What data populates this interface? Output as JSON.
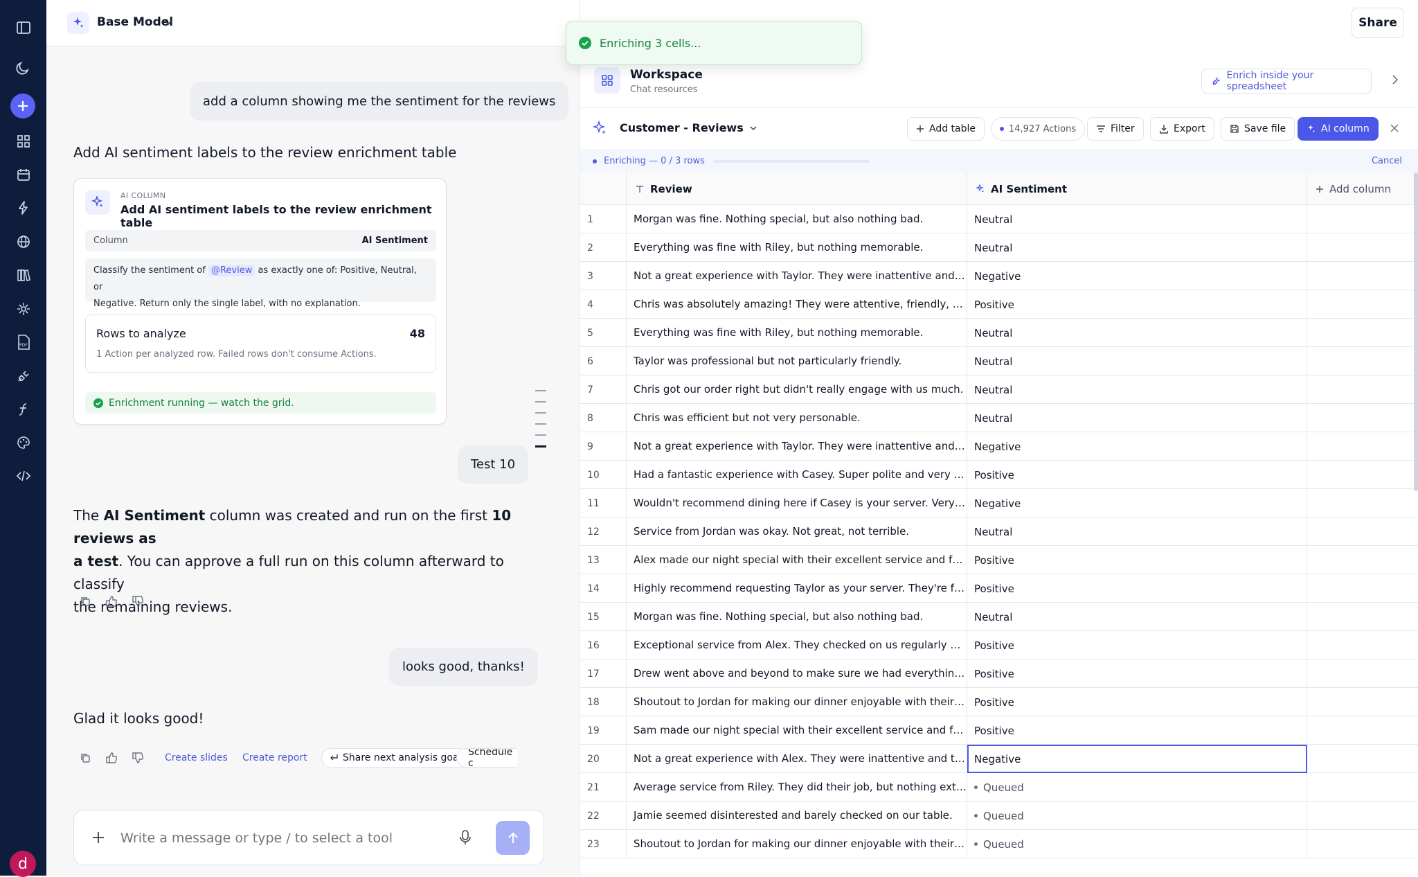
{
  "toast": {
    "text": "Enriching 3 cells..."
  },
  "chat": {
    "model_name": "Base Model",
    "user_msg_1": "add a column showing me the sentiment for the reviews",
    "assistant_heading": "Add AI sentiment labels to the review enrichment table",
    "card": {
      "kicker": "AI COLUMN",
      "title": "Add AI sentiment labels to the review enrichment table",
      "column_key": "Column",
      "column_value": "AI Sentiment",
      "prompt_prefix": "Classify the sentiment of",
      "prompt_mention": "@Review",
      "prompt_line1_rest": "as exactly one of: Positive, Neutral, or",
      "prompt_line2": "Negative. Return only the single label, with no explanation.",
      "rows_label": "Rows to analyze",
      "rows_count": "48",
      "rows_desc": "1 Action per analyzed row. Failed rows don't consume Actions.",
      "status": "Enrichment running — watch the grid."
    },
    "user_msg_2": "Test 10",
    "assistant_msg_2": {
      "p1": "The ",
      "b1": "AI Sentiment",
      "p2": " column was created and run on the first ",
      "b2": "10 reviews as",
      "b3": "a test",
      "p3": ". You can approve a full run on this column afterward to classify",
      "p4": "the remaining reviews."
    },
    "user_msg_3": "looks good, thanks!",
    "assistant_msg_3": "Glad it looks good!",
    "actions": {
      "create_slides": "Create slides",
      "create_report": "Create report",
      "share_goal": "Share next analysis goal",
      "schedule": "Schedule c"
    },
    "composer_placeholder": "Write a message or type / to select a tool"
  },
  "panel": {
    "share_label": "Share",
    "workspace_title": "Workspace",
    "workspace_sub": "Chat resources",
    "enrich_link": "Enrich inside your spreadsheet",
    "table_title": "Customer - Reviews",
    "add_table": "Add table",
    "actions_count": "14,927 Actions",
    "filter": "Filter",
    "export": "Export",
    "save_file": "Save file",
    "ai_column": "AI column",
    "progress_text": "Enriching — 0 / 3 rows",
    "progress_fraction": 0.0,
    "cancel": "Cancel",
    "col_review": "Review",
    "col_sentiment": "AI Sentiment",
    "col_add": "Add column",
    "rows": [
      {
        "n": "1",
        "review": "Morgan was fine. Nothing special, but also nothing bad.",
        "sentiment": "Neutral"
      },
      {
        "n": "2",
        "review": "Everything was fine with Riley, but nothing memorable.",
        "sentiment": "Neutral"
      },
      {
        "n": "3",
        "review": "Not a great experience with Taylor. They were inattentive and took...",
        "sentiment": "Negative"
      },
      {
        "n": "4",
        "review": "Chris was absolutely amazing! They were attentive, friendly, and m...",
        "sentiment": "Positive"
      },
      {
        "n": "5",
        "review": "Everything was fine with Riley, but nothing memorable.",
        "sentiment": "Neutral"
      },
      {
        "n": "6",
        "review": "Taylor was professional but not particularly friendly.",
        "sentiment": "Neutral"
      },
      {
        "n": "7",
        "review": "Chris got our order right but didn't really engage with us much.",
        "sentiment": "Neutral"
      },
      {
        "n": "8",
        "review": "Chris was efficient but not very personable.",
        "sentiment": "Neutral"
      },
      {
        "n": "9",
        "review": "Not a great experience with Taylor. They were inattentive and took...",
        "sentiment": "Negative"
      },
      {
        "n": "10",
        "review": "Had a fantastic experience with Casey. Super polite and very effici...",
        "sentiment": "Positive"
      },
      {
        "n": "11",
        "review": "Wouldn't recommend dining here if Casey is your server. Very inatt...",
        "sentiment": "Negative"
      },
      {
        "n": "12",
        "review": "Service from Jordan was okay. Not great, not terrible.",
        "sentiment": "Neutral"
      },
      {
        "n": "13",
        "review": "Alex made our night special with their excellent service and friendl...",
        "sentiment": "Positive"
      },
      {
        "n": "14",
        "review": "Highly recommend requesting Taylor as your server. They're fanta...",
        "sentiment": "Positive"
      },
      {
        "n": "15",
        "review": "Morgan was fine. Nothing special, but also nothing bad.",
        "sentiment": "Neutral"
      },
      {
        "n": "16",
        "review": "Exceptional service from Alex. They checked on us regularly and e...",
        "sentiment": "Positive"
      },
      {
        "n": "17",
        "review": "Drew went above and beyond to make sure we had everything we ...",
        "sentiment": "Positive"
      },
      {
        "n": "18",
        "review": "Shoutout to Jordan for making our dinner enjoyable with their kind...",
        "sentiment": "Positive"
      },
      {
        "n": "19",
        "review": "Sam made our night special with their excellent service and friendl...",
        "sentiment": "Positive"
      },
      {
        "n": "20",
        "review": "Not a great experience with Alex. They were inattentive and took f...",
        "sentiment": "Negative",
        "selected": true
      },
      {
        "n": "21",
        "review": "Average service from Riley. They did their job, but nothing extraor...",
        "sentiment": "Queued",
        "queued": true
      },
      {
        "n": "22",
        "review": "Jamie seemed disinterested and barely checked on our table.",
        "sentiment": "Queued",
        "queued": true
      },
      {
        "n": "23",
        "review": "Shoutout to Jordan for making our dinner enjoyable with their kind...",
        "sentiment": "Queued",
        "queued": true
      }
    ]
  },
  "colors": {
    "rail": "#0f1d3d",
    "accent": "#4a57e8",
    "success": "#15803d",
    "user_avatar": "#c2185b"
  },
  "icons": {
    "rail": [
      "sidebar-toggle-icon",
      "moon-icon",
      "plus-icon",
      "grid-icon",
      "calendar-icon",
      "bolt-icon",
      "globe-icon",
      "library-icon",
      "sparkle-plug-icon",
      "pdf-icon",
      "plug-icon",
      "function-icon",
      "palette-icon",
      "code-icon"
    ],
    "user_avatar_letter": "d"
  }
}
